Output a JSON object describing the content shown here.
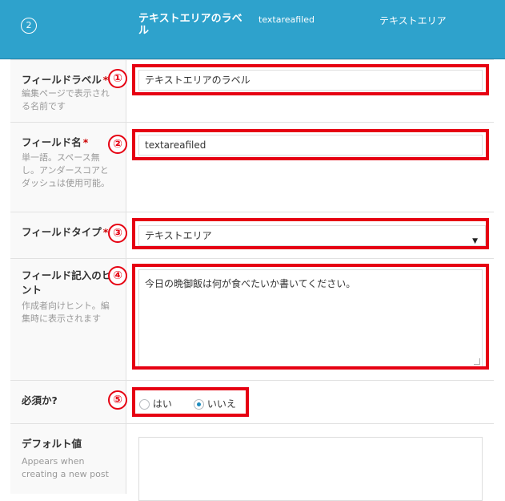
{
  "header": {
    "order": "2",
    "field_label": "テキストエリアのラベル",
    "field_name": "textareafiled",
    "field_type": "テキストエリア"
  },
  "rows": {
    "label": {
      "title": "フィールドラベル",
      "required": "*",
      "desc": "編集ページで表示される名前です",
      "value": "テキストエリアのラベル"
    },
    "name": {
      "title": "フィールド名",
      "required": "*",
      "desc": "単一語。スペース無し。アンダースコアとダッシュは使用可能。",
      "value": "textareafiled"
    },
    "type": {
      "title": "フィールドタイプ",
      "required": "*",
      "value": "テキストエリア"
    },
    "hint": {
      "title": "フィールド記入のヒント",
      "desc": "作成者向けヒント。編集時に表示されます",
      "value": "今日の晩御飯は何が食べたいか書いてください。"
    },
    "required_q": {
      "title": "必須か?",
      "options": [
        "はい",
        "いいえ"
      ],
      "selected": "いいえ"
    },
    "default": {
      "title": "デフォルト値",
      "desc": "Appears when creating a new post"
    }
  },
  "badges": [
    "①",
    "②",
    "③",
    "④",
    "⑤"
  ],
  "colors": {
    "header_bg": "#2ea2cc",
    "highlight": "#e60012",
    "radio_checked": "#1e8cbe"
  }
}
